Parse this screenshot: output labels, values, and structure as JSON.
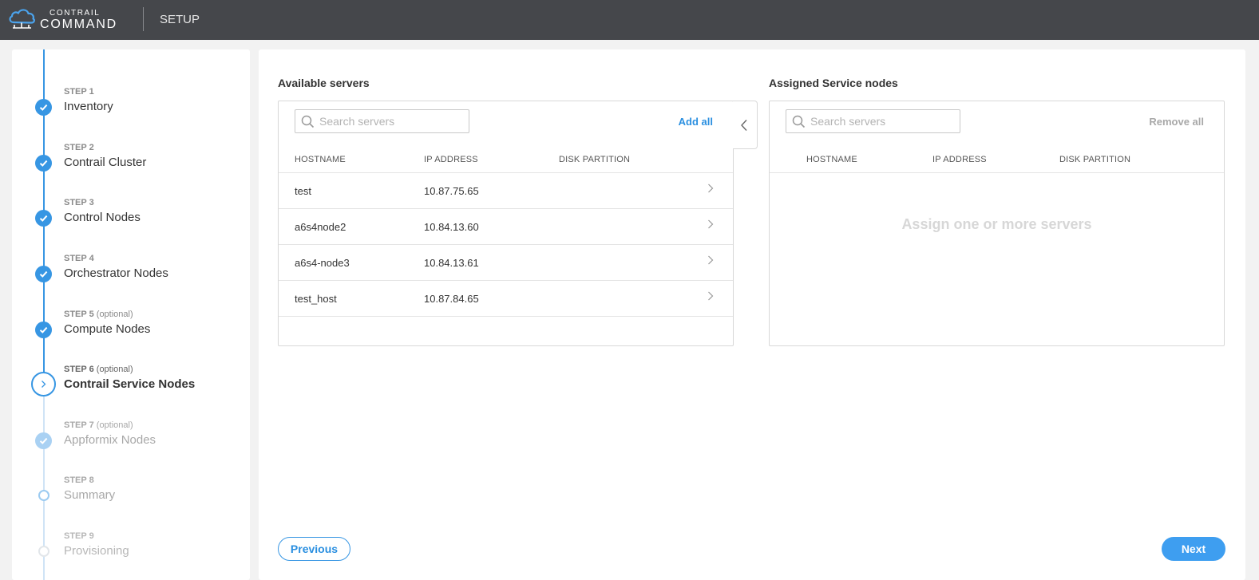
{
  "header": {
    "brand_top": "CONTRAIL",
    "brand_bottom": "COMMAND",
    "section": "SETUP",
    "logo_icon": "cloud-network-icon"
  },
  "steps": [
    {
      "label": "STEP 1",
      "optional": "",
      "title": "Inventory",
      "state": "done"
    },
    {
      "label": "STEP 2",
      "optional": "",
      "title": "Contrail Cluster",
      "state": "done"
    },
    {
      "label": "STEP 3",
      "optional": "",
      "title": "Control Nodes",
      "state": "done"
    },
    {
      "label": "STEP 4",
      "optional": "",
      "title": "Orchestrator Nodes",
      "state": "done"
    },
    {
      "label": "STEP 5",
      "optional": "(optional)",
      "title": "Compute Nodes",
      "state": "done"
    },
    {
      "label": "STEP 6",
      "optional": "(optional)",
      "title": "Contrail Service Nodes",
      "state": "current"
    },
    {
      "label": "STEP 7",
      "optional": "(optional)",
      "title": "Appformix Nodes",
      "state": "done-disabled"
    },
    {
      "label": "STEP 8",
      "optional": "",
      "title": "Summary",
      "state": "todo"
    },
    {
      "label": "STEP 9",
      "optional": "",
      "title": "Provisioning",
      "state": "todo-disabled"
    }
  ],
  "available": {
    "title": "Available servers",
    "search_placeholder": "Search servers",
    "action": "Add all",
    "columns": [
      "HOSTNAME",
      "IP ADDRESS",
      "DISK PARTITION"
    ],
    "rows": [
      {
        "hostname": "test",
        "ip": "10.87.75.65",
        "disk": ""
      },
      {
        "hostname": "a6s4node2",
        "ip": "10.84.13.60",
        "disk": ""
      },
      {
        "hostname": "a6s4-node3",
        "ip": "10.84.13.61",
        "disk": ""
      },
      {
        "hostname": "test_host",
        "ip": "10.87.84.65",
        "disk": ""
      }
    ]
  },
  "assigned": {
    "title": "Assigned Service nodes",
    "search_placeholder": "Search servers",
    "action": "Remove all",
    "columns": [
      "HOSTNAME",
      "IP ADDRESS",
      "DISK PARTITION"
    ],
    "empty_message": "Assign one or more servers"
  },
  "buttons": {
    "previous": "Previous",
    "next": "Next"
  },
  "colors": {
    "accent": "#3796e3",
    "topbar": "#45474b"
  }
}
